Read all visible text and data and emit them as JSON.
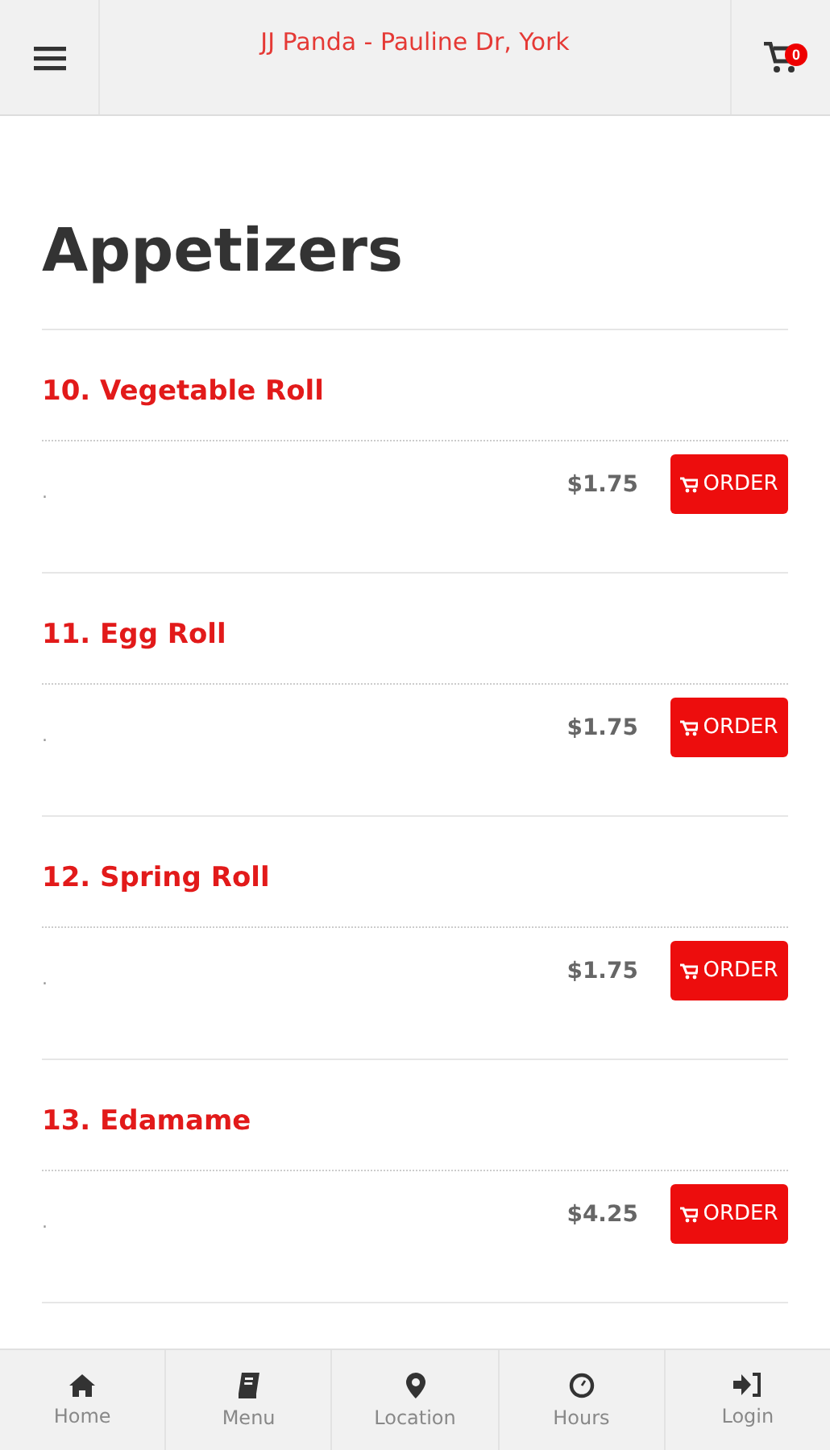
{
  "header": {
    "title": "JJ Panda - Pauline Dr, York",
    "cart_count": "0"
  },
  "section": {
    "title": "Appetizers"
  },
  "items": [
    {
      "name": "10. Vegetable Roll",
      "description": ".",
      "price": "$1.75",
      "button": "ORDER"
    },
    {
      "name": "11. Egg Roll",
      "description": ".",
      "price": "$1.75",
      "button": "ORDER"
    },
    {
      "name": "12. Spring Roll",
      "description": ".",
      "price": "$1.75",
      "button": "ORDER"
    },
    {
      "name": "13. Edamame",
      "description": ".",
      "price": "$4.25",
      "button": "ORDER"
    }
  ],
  "nav": [
    {
      "kind": "home",
      "label": "Home"
    },
    {
      "kind": "menu",
      "label": "Menu"
    },
    {
      "kind": "location",
      "label": "Location"
    },
    {
      "kind": "hours",
      "label": "Hours"
    },
    {
      "kind": "login",
      "label": "Login"
    }
  ]
}
